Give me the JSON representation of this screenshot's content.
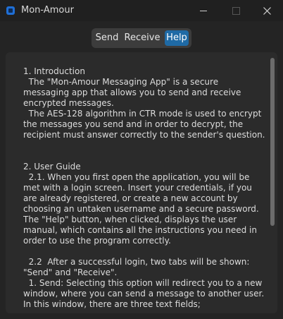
{
  "window": {
    "title": "Mon-Amour"
  },
  "tabs": [
    {
      "label": "Send"
    },
    {
      "label": "Receive"
    },
    {
      "label": "Help"
    }
  ],
  "active_tab": "Help",
  "help_text": "1. Introduction\n  The \"Mon-Amour Messaging App\" is a secure messaging app that allows you to send and receive encrypted messages.\n  The AES-128 algorithm in CTR mode is used to encrypt the messages you send and in order to decrypt, the recipient must answer correctly to the sender's question.\n\n\n2. User Guide\n  2.1. When you first open the application, you will be met with a login screen. Insert your credentials, if you are already registered, or create a new account by choosing an untaken username and a secure password.\nThe \"Help\" button, when clicked, displays the user manual, which contains all the instructions you need in order to use the program correctly.\n\n  2.2  After a successful login, two tabs will be shown: \"Send\" and \"Receive\".\n  1. Send: Selecting this option will redirect you to a new window, where you can send a message to another user. In this window, there are three text fields;",
  "colors": {
    "accent": "#1f6aa5",
    "background": "#242424",
    "panel": "#2b2b2b"
  }
}
